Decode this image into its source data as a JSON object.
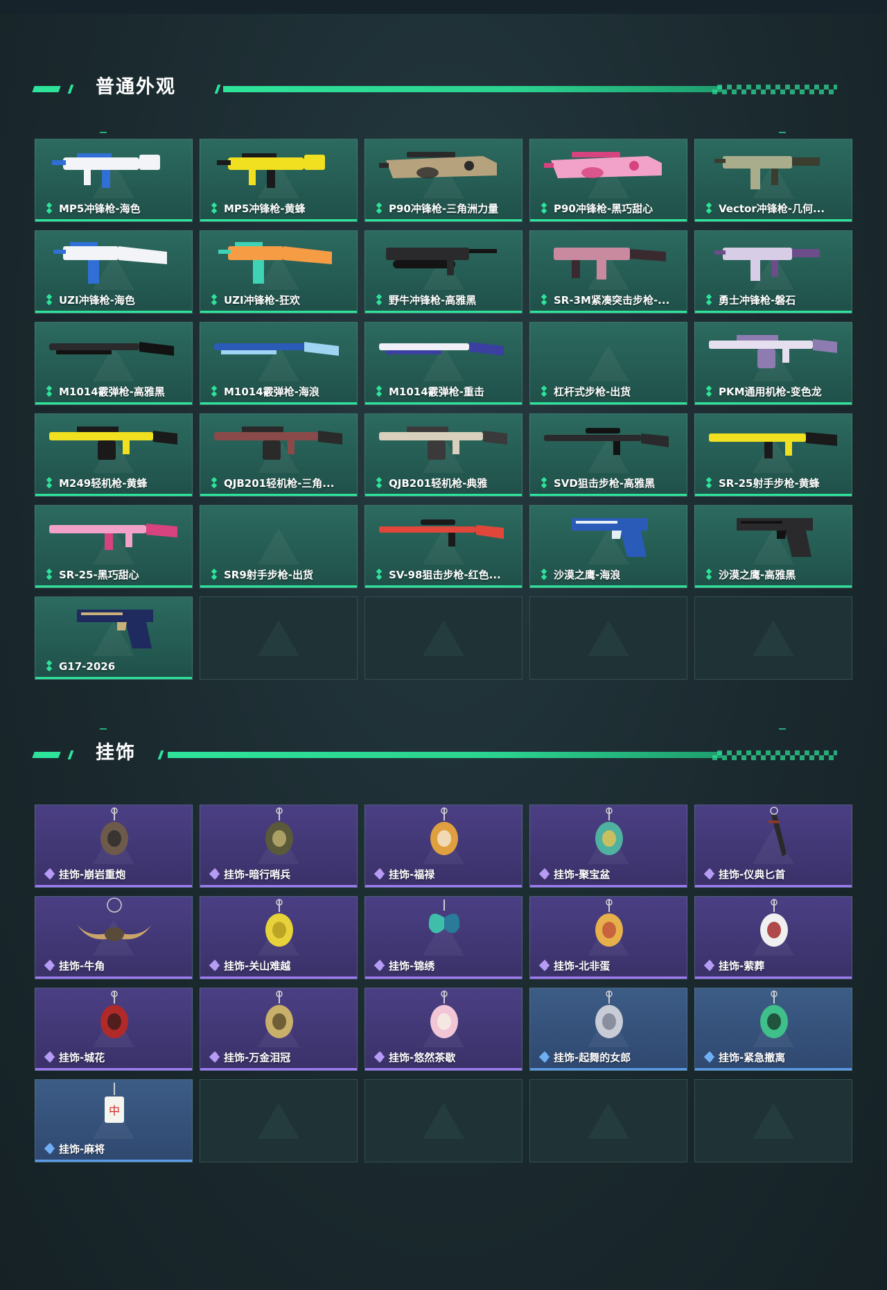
{
  "sections": {
    "normal": {
      "title": "普通外观",
      "items": [
        {
          "label": "MP5冲锋枪-海色",
          "rarity": "green",
          "art": "smg",
          "c1": "#f2f4f8",
          "c2": "#2f6fd6"
        },
        {
          "label": "MP5冲锋枪-黄蜂",
          "rarity": "green",
          "art": "smg",
          "c1": "#f1e01f",
          "c2": "#1a1a1a"
        },
        {
          "label": "P90冲锋枪-三角洲力量",
          "rarity": "green",
          "art": "p90",
          "c1": "#b7a27e",
          "c2": "#2a2a2a"
        },
        {
          "label": "P90冲锋枪-黑巧甜心",
          "rarity": "green",
          "art": "p90",
          "c1": "#f2a2c8",
          "c2": "#d6437f"
        },
        {
          "label": "Vector冲锋枪-几何...",
          "rarity": "green",
          "art": "vector",
          "c1": "#a9ad8c",
          "c2": "#3b3d2e"
        },
        {
          "label": "UZI冲锋枪-海色",
          "rarity": "green",
          "art": "uzi",
          "c1": "#f2f4f8",
          "c2": "#2f6fd6"
        },
        {
          "label": "UZI冲锋枪-狂欢",
          "rarity": "green",
          "art": "uzi",
          "c1": "#f59c45",
          "c2": "#3fd3b6"
        },
        {
          "label": "野牛冲锋枪-高雅黑",
          "rarity": "green",
          "art": "bizon",
          "c1": "#2a2a2c",
          "c2": "#141414"
        },
        {
          "label": "SR-3M紧凑突击步枪-...",
          "rarity": "green",
          "art": "sr3m",
          "c1": "#c98aa0",
          "c2": "#3a2a30"
        },
        {
          "label": "勇士冲锋枪-磐石",
          "rarity": "green",
          "art": "vector",
          "c1": "#d8cde6",
          "c2": "#6d4c8a"
        },
        {
          "label": "M1014霰弹枪-高雅黑",
          "rarity": "green",
          "art": "shotgun",
          "c1": "#2a2a2c",
          "c2": "#121212"
        },
        {
          "label": "M1014霰弹枪-海浪",
          "rarity": "green",
          "art": "shotgun",
          "c1": "#2a5bb8",
          "c2": "#9fd4f2"
        },
        {
          "label": "M1014霰弹枪-重击",
          "rarity": "green",
          "art": "shotgun",
          "c1": "#f0eef6",
          "c2": "#3a3fa0"
        },
        {
          "label": "杠杆式步枪-出货",
          "rarity": "green",
          "art": "none",
          "c1": "#000000",
          "c2": "#000000"
        },
        {
          "label": "PKM通用机枪-变色龙",
          "rarity": "green",
          "art": "lmg",
          "c1": "#e6dff0",
          "c2": "#8e7cb0"
        },
        {
          "label": "M249轻机枪-黄蜂",
          "rarity": "green",
          "art": "lmg",
          "c1": "#f1e01f",
          "c2": "#1a1a1a"
        },
        {
          "label": "QJB201轻机枪-三角...",
          "rarity": "green",
          "art": "lmg",
          "c1": "#8a4a4a",
          "c2": "#2a2a2a"
        },
        {
          "label": "QJB201轻机枪-典雅",
          "rarity": "green",
          "art": "lmg",
          "c1": "#d8d0bd",
          "c2": "#3a3a3a"
        },
        {
          "label": "SVD狙击步枪-高雅黑",
          "rarity": "green",
          "art": "sniper",
          "c1": "#2a2a2c",
          "c2": "#121212"
        },
        {
          "label": "SR-25射手步枪-黄蜂",
          "rarity": "green",
          "art": "rifle",
          "c1": "#f1e01f",
          "c2": "#1a1a1a"
        },
        {
          "label": "SR-25-黑巧甜心",
          "rarity": "green",
          "art": "rifle",
          "c1": "#f2a2c8",
          "c2": "#d6437f"
        },
        {
          "label": "SR9射手步枪-出货",
          "rarity": "green",
          "art": "none",
          "c1": "#000000",
          "c2": "#000000"
        },
        {
          "label": "SV-98狙击步枪-红色...",
          "rarity": "green",
          "art": "sniper",
          "c1": "#e0473a",
          "c2": "#1a1a1a"
        },
        {
          "label": "沙漠之鹰-海浪",
          "rarity": "green",
          "art": "pistol",
          "c1": "#2a5bb8",
          "c2": "#e6eef6"
        },
        {
          "label": "沙漠之鹰-高雅黑",
          "rarity": "green",
          "art": "pistol",
          "c1": "#2a2a2c",
          "c2": "#121212"
        },
        {
          "label": "G17-2026",
          "rarity": "green",
          "art": "pistol",
          "c1": "#1f2a5e",
          "c2": "#c9b27a"
        }
      ],
      "empty_count": 4
    },
    "charms": {
      "title": "挂饰",
      "items": [
        {
          "label": "挂饰-崩岩重炮",
          "rarity": "purple",
          "art": "charm",
          "c1": "#6e5a4a",
          "c2": "#2a2a2a"
        },
        {
          "label": "挂饰-暗行哨兵",
          "rarity": "purple",
          "art": "charm",
          "c1": "#5a5a3a",
          "c2": "#c0b070"
        },
        {
          "label": "挂饰-福禄",
          "rarity": "purple",
          "art": "charm",
          "c1": "#e0a040",
          "c2": "#f5e8d0"
        },
        {
          "label": "挂饰-聚宝盆",
          "rarity": "purple",
          "art": "charm",
          "c1": "#4fb2a0",
          "c2": "#e6c250"
        },
        {
          "label": "挂饰-仪典匕首",
          "rarity": "purple",
          "art": "dagger",
          "c1": "#2a2a2a",
          "c2": "#8a3a2a"
        },
        {
          "label": "挂饰-牛角",
          "rarity": "purple",
          "art": "horns",
          "c1": "#c9a56a",
          "c2": "#5a4a3a"
        },
        {
          "label": "挂饰-关山难越",
          "rarity": "purple",
          "art": "charm",
          "c1": "#e8d23a",
          "c2": "#b09a20"
        },
        {
          "label": "挂饰-锦绣",
          "rarity": "purple",
          "art": "butterfly",
          "c1": "#3fbfaa",
          "c2": "#2a7a9a"
        },
        {
          "label": "挂饰-北非蛋",
          "rarity": "purple",
          "art": "charm",
          "c1": "#e6b04a",
          "c2": "#c0503a"
        },
        {
          "label": "挂饰-萦葬",
          "rarity": "purple",
          "art": "charm",
          "c1": "#f0f0f0",
          "c2": "#a02020"
        },
        {
          "label": "挂饰-城花",
          "rarity": "purple",
          "art": "charm",
          "c1": "#b02a2a",
          "c2": "#3a1a1a"
        },
        {
          "label": "挂饰-万金泪冠",
          "rarity": "purple",
          "art": "charm",
          "c1": "#c9b06a",
          "c2": "#5a4a2a"
        },
        {
          "label": "挂饰-悠然茶歇",
          "rarity": "purple",
          "art": "charm",
          "c1": "#f2c6d6",
          "c2": "#f5f0e6"
        },
        {
          "label": "挂饰-起舞的女郎",
          "rarity": "blue",
          "art": "charm",
          "c1": "#c8ccd6",
          "c2": "#7a808e"
        },
        {
          "label": "挂饰-紧急撤离",
          "rarity": "blue",
          "art": "charm",
          "c1": "#3fbf8a",
          "c2": "#1a3a2a"
        },
        {
          "label": "挂饰-麻将",
          "rarity": "blue",
          "art": "mahjong",
          "c1": "#f5f5f0",
          "c2": "#d02a2a"
        }
      ],
      "empty_count": 4
    }
  },
  "colors": {
    "accent": "#2ee39a",
    "green_card": "#2c6a5f",
    "purple_card": "#4b3f84",
    "blue_card": "#3c5c86",
    "background": "#1b2a2f"
  }
}
